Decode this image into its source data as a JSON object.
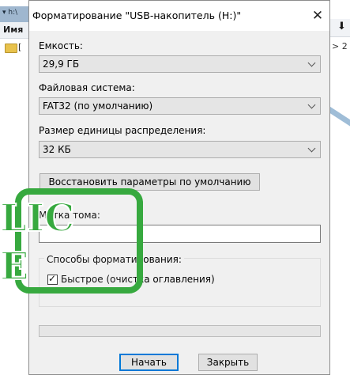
{
  "background": {
    "title_fragment": "▾ h:\\",
    "header_fragment": "Имя",
    "folder_fragment": "[",
    "right_arrow": "⬇",
    "right_fragment": "> 2"
  },
  "dialog": {
    "title": "Форматирование \"USB-накопитель (H:)\"",
    "close_glyph": "✕",
    "capacity": {
      "label": "Емкость:",
      "value": "29,9 ГБ"
    },
    "filesystem": {
      "label": "Файловая система:",
      "value": "FAT32 (по умолчанию)"
    },
    "cluster": {
      "label": "Размер единицы распределения:",
      "value": "32 КБ"
    },
    "restore_defaults_label": "Восстановить параметры по умолчанию",
    "volume_label": {
      "label": "Метка тома:",
      "value": ""
    },
    "format_options": {
      "label": "Способы форматирования:",
      "quick_format_label": "Быстрое (очистка оглавления)",
      "quick_format_checked": true,
      "check_glyph": "✓"
    },
    "progress": 0,
    "start_label": "Начать",
    "close_label": "Закрыть"
  },
  "watermark": {
    "line1": "LIC",
    "line2": "E",
    "color": "#37a93f"
  },
  "colors": {
    "accent": "#0078d7",
    "progress": "#06b025"
  }
}
